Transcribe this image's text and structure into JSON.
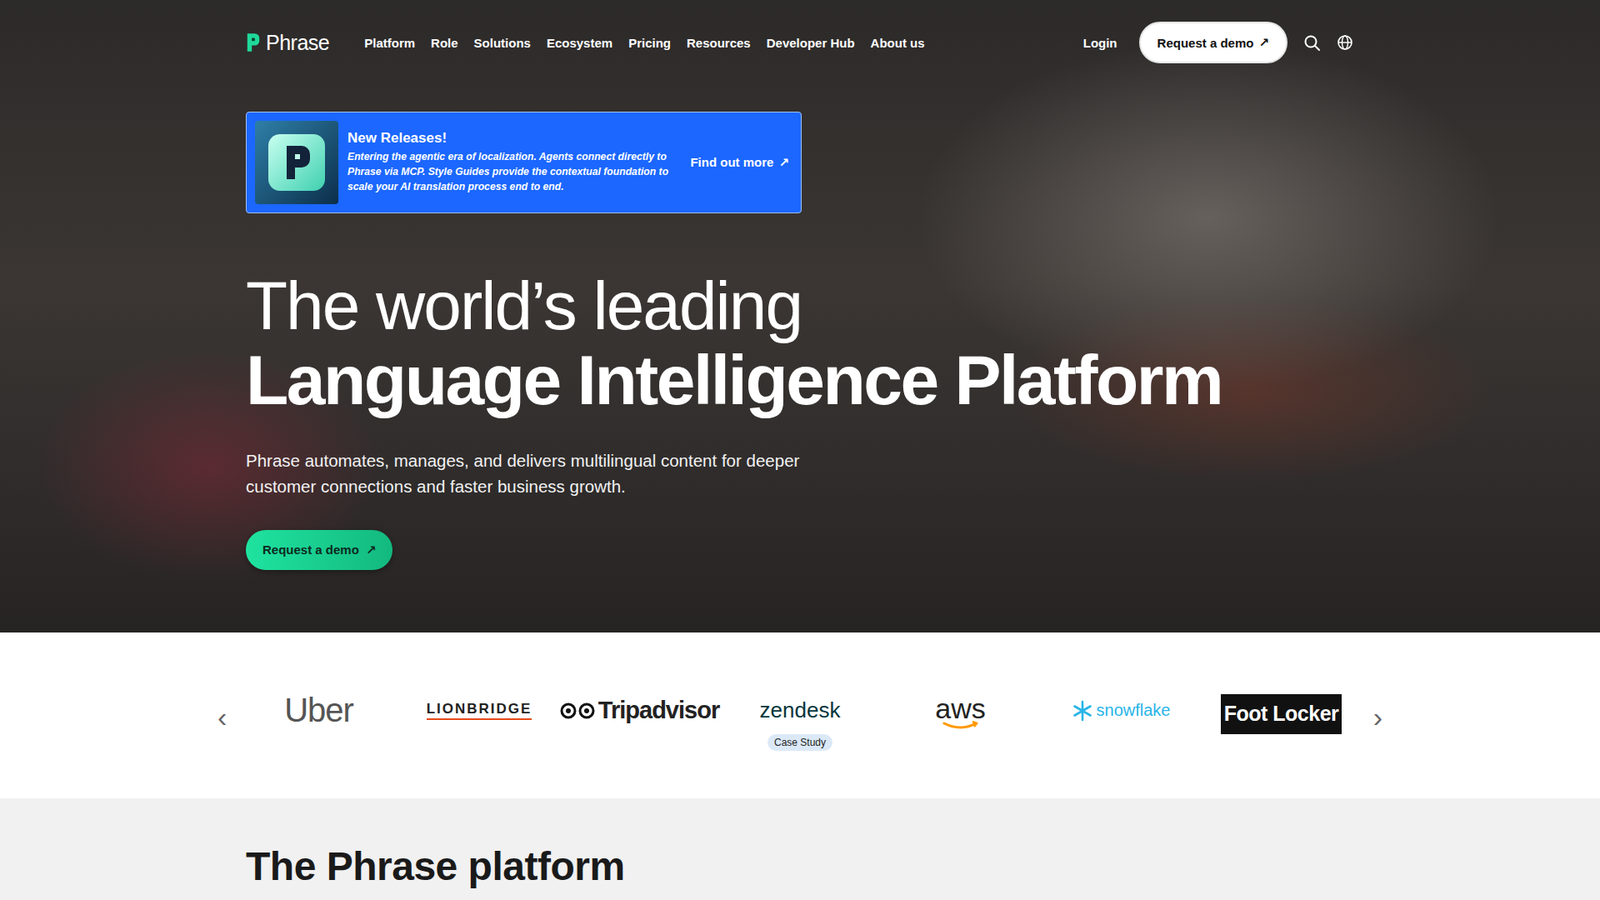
{
  "nav": {
    "logo": "Phrase",
    "items": [
      "Platform",
      "Role",
      "Solutions",
      "Ecosystem",
      "Pricing",
      "Resources",
      "Developer Hub",
      "About us"
    ],
    "login": "Login",
    "demo": "Request a demo",
    "demo_icon": "↗"
  },
  "banner": {
    "title": "New Releases!",
    "text": "Entering the agentic era of localization. Agents connect directly to Phrase via MCP. Style Guides provide the contextual foundation to scale your AI translation process end to end.",
    "link": "Find out more",
    "link_icon": "↗"
  },
  "hero": {
    "line1": "The world’s leading",
    "line2": "Language Intelligence Platform",
    "subtitle": "Phrase automates, manages, and delivers multilingual content for deeper customer connections and faster business growth.",
    "cta": "Request a demo",
    "cta_icon": "↗"
  },
  "carousel": {
    "prev": "‹",
    "next": "›",
    "logos": [
      {
        "text": "Uber",
        "kind": "uber"
      },
      {
        "text": "LIONBRIDGE",
        "kind": "lionbridge"
      },
      {
        "text": "Tripadvisor",
        "kind": "tripadvisor"
      },
      {
        "text": "zendesk",
        "kind": "zendesk",
        "badge": "Case Study"
      },
      {
        "text": "aws",
        "kind": "aws"
      },
      {
        "text": "snowflake",
        "kind": "snowflake"
      },
      {
        "text": "Foot Locker",
        "kind": "footlocker"
      }
    ]
  },
  "platform": {
    "title": "The Phrase platform"
  }
}
